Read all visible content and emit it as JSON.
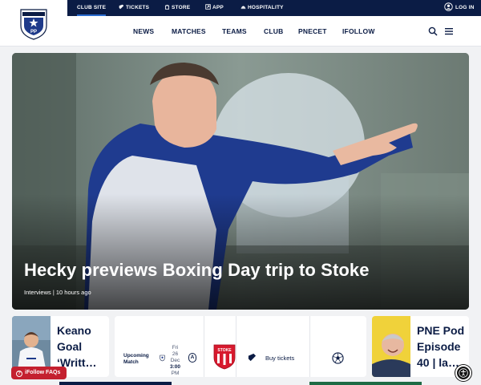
{
  "topbar": {
    "club_site": "CLUB SITE",
    "tickets": "TICKETS",
    "store": "STORE",
    "app": "APP",
    "hospitality": "HOSPITALITY",
    "login": "LOG IN"
  },
  "nav": {
    "items": [
      "NEWS",
      "MATCHES",
      "TEAMS",
      "CLUB",
      "PNECET",
      "IFOLLOW"
    ]
  },
  "crest": {
    "initials": "PP"
  },
  "hero": {
    "title": "Hecky previews Boxing Day trip to Stoke",
    "meta": "Interviews | 10 hours ago"
  },
  "cards": {
    "news_title": "Keano Goal ‘Writt…",
    "upcoming_label_1": "Upcoming",
    "upcoming_label_2": "Match",
    "date_day": "Fri",
    "date_num": "26",
    "date_month": "Dec",
    "date_time": "3:00",
    "date_ampm": "PM",
    "venue_badge": "A",
    "opponent_crest_text": "STOKE",
    "buy_tickets": "Buy tickets",
    "podcast_title": "PNE Pod Episode 40 | la…"
  },
  "faq": {
    "label": "iFollow FAQs",
    "icon_char": "?"
  },
  "colors": {
    "navy": "#0b1c45",
    "accent_blue": "#2a6ccf",
    "faq_red": "#c4202f",
    "stoke_red": "#d7192d"
  },
  "icons": [
    "ticket-icon",
    "store-icon",
    "app-icon",
    "hospitality-icon",
    "user-icon",
    "search-icon",
    "menu-icon",
    "ticket-icon",
    "football-icon",
    "accessibility-icon"
  ]
}
